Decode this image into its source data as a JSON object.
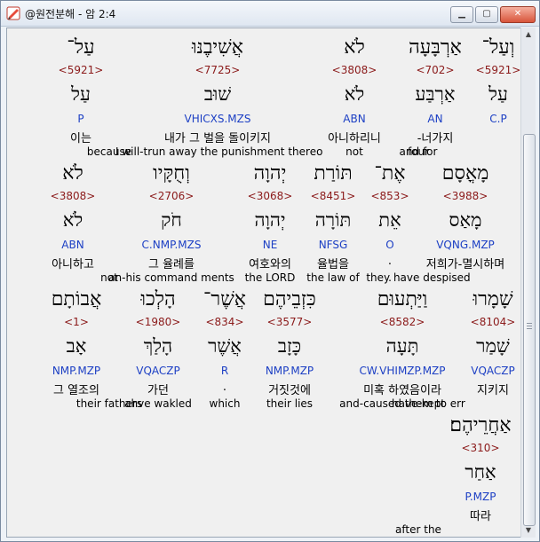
{
  "window": {
    "title": "@원전분해 - 암 2:4",
    "minimize_icon": "minimize-icon",
    "maximize_icon": "maximize-icon",
    "close_icon": "close-icon"
  },
  "rows": [
    [
      {
        "heb": "וְעַל־",
        "strong": "<5921>",
        "lemma": "עַל",
        "morph": "C.P",
        "kor": "",
        "eng": "and for"
      },
      {
        "heb": "אַרְבָּעָה",
        "strong": "<702>",
        "lemma": "אַרְבַּע",
        "morph": "AN",
        "kor": "-너가지",
        "eng": "four"
      },
      {
        "heb": "לֹא",
        "strong": "<3808>",
        "lemma": "לֹא",
        "morph": "ABN",
        "kor": "아니하리니",
        "eng": "not"
      },
      {
        "heb": "אֲשִׁיבֶנּוּ",
        "strong": "<7725>",
        "lemma": "שׁוּב",
        "morph": "VHICXS.MZS",
        "kor": "내가 그 벌을 돌이키지",
        "eng": "I will-trun away the punishment thereo"
      },
      {
        "heb": "עַל־",
        "strong": "<5921>",
        "lemma": "עַל",
        "morph": "P",
        "kor": "이는",
        "eng": "because"
      }
    ],
    [
      {
        "heb": "מָאֳסָם",
        "strong": "<3988>",
        "lemma": "מָאַס",
        "morph": "VQNG.MZP",
        "kor": "저희가-멸시하며",
        "eng": "they have despised"
      },
      {
        "heb": "אֶת־",
        "strong": "<853>",
        "lemma": "אֵת",
        "morph": "O",
        "kor": ".",
        "eng": "."
      },
      {
        "heb": "תּוֹרַת",
        "strong": "<8451>",
        "lemma": "תּוֹרָה",
        "morph": "NFSG",
        "kor": "율법을",
        "eng": "the law of"
      },
      {
        "heb": "יְהוָה",
        "strong": "<3068>",
        "lemma": "יְהוָה",
        "morph": "NE",
        "kor": "여호와의",
        "eng": "the LORD"
      },
      {
        "heb": "וְחֻקָּיו",
        "strong": "<2706>",
        "lemma": "חֹק",
        "morph": "C.NMP.MZS",
        "kor": "그 율례를",
        "eng": "an-his command ments"
      },
      {
        "heb": "לֹא",
        "strong": "<3808>",
        "lemma": "לֹא",
        "morph": "ABN",
        "kor": "아니하고",
        "eng": "not"
      }
    ],
    [
      {
        "heb": "שָׁמָרוּ",
        "strong": "<8104>",
        "lemma": "שָׁמַר",
        "morph": "VQACZP",
        "kor": "지키지",
        "eng": "have-kept"
      },
      {
        "heb": "וַיַּתְעוּם",
        "strong": "<8582>",
        "lemma": "תָּעָה",
        "morph": "CW.VHIMZP.MZP",
        "kor": "미혹 하였음이라",
        "eng": "and-caused them to err"
      },
      {
        "heb": "כִּזְבֵיהֶם",
        "strong": "<3577>",
        "lemma": "כָּזָב",
        "morph": "NMP.MZP",
        "kor": "거짓것에",
        "eng": "their lies"
      },
      {
        "heb": "אֲשֶׁר־",
        "strong": "<834>",
        "lemma": "אֲשֶׁר",
        "morph": "R",
        "kor": ".",
        "eng": "which"
      },
      {
        "heb": "הָלְכוּ",
        "strong": "<1980>",
        "lemma": "הָלַךְ",
        "morph": "VQACZP",
        "kor": "가던",
        "eng": "ahve wakled"
      },
      {
        "heb": "אֲבוֹתָם",
        "strong": "<1>",
        "lemma": "אָב",
        "morph": "NMP.MZP",
        "kor": "그 열조의",
        "eng": "their fathers"
      }
    ],
    [
      {
        "heb": "אַחֲרֵיהֶם׃",
        "strong": "<310>",
        "lemma": "אַחַר",
        "morph": "P.MZP",
        "kor": "따라",
        "eng": "after the"
      }
    ]
  ]
}
